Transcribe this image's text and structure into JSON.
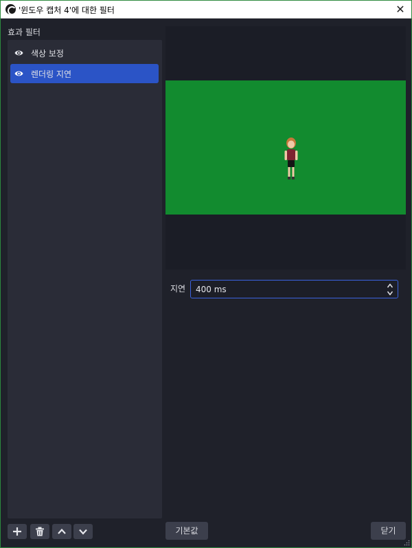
{
  "window": {
    "title": "'윈도우 캡처 4'에 대한 필터",
    "close_glyph": "✕"
  },
  "filters": {
    "label": "효과 필터",
    "items": [
      {
        "label": "색상 보정",
        "icon": "eye-icon",
        "visible": true,
        "selected": false
      },
      {
        "label": "렌더링 지연",
        "icon": "eye-icon",
        "visible": true,
        "selected": true
      }
    ]
  },
  "toolbar": {
    "icons": [
      "plus-icon",
      "trash-icon",
      "chevron-up-icon",
      "chevron-down-icon"
    ]
  },
  "properties": {
    "delay_label": "지연",
    "delay_value": "400 ms"
  },
  "buttons": {
    "defaults_label": "기본값",
    "close_label": "닫기"
  },
  "colors": {
    "selection": "#2b54c6",
    "chroma_green": "#128b2f",
    "focus_border": "#3b63e0",
    "background": "#1f212a"
  }
}
